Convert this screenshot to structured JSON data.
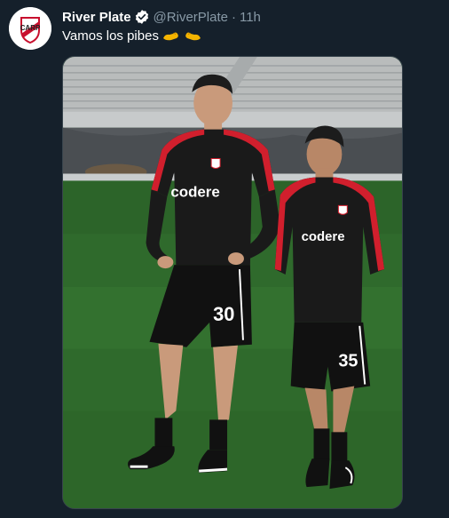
{
  "tweet": {
    "author_name": "River Plate",
    "handle": "@RiverPlate",
    "separator": "·",
    "timestamp": "11h",
    "text": "Vamos los pibes",
    "emojis": [
      "flexed-arm-emoji",
      "flexed-arm-emoji"
    ],
    "verified": true
  },
  "media": {
    "icon": "photo",
    "jersey_sponsor": "codere",
    "player_numbers": [
      "30",
      "35"
    ],
    "colors": {
      "shirt": "#1a1a1a",
      "stripe": "#d11f2d",
      "pitch": "#2f6a2c"
    }
  },
  "colors": {
    "background": "#15202b",
    "text_primary": "#ffffff",
    "text_secondary": "#8899a6",
    "verified": "#ffffff",
    "border": "#38444d"
  }
}
